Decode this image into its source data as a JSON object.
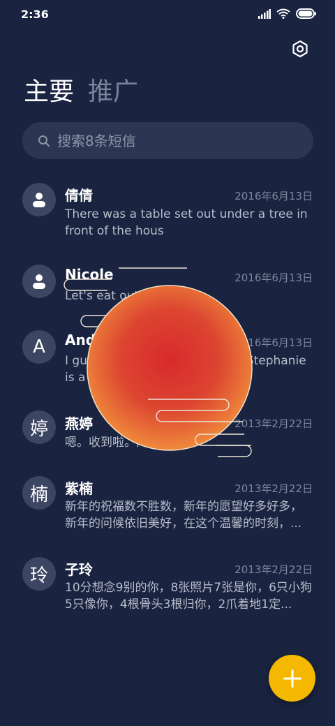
{
  "status_bar": {
    "time": "2:36"
  },
  "tabs": [
    {
      "label": "主要",
      "active": true
    },
    {
      "label": "推广",
      "active": false
    }
  ],
  "search": {
    "placeholder": "搜索8条短信"
  },
  "messages": [
    {
      "avatar": "person-icon",
      "name": "倩倩",
      "date": "2016年6月13日",
      "preview": "There was a table set out under a tree in front of the hous"
    },
    {
      "avatar": "person-icon",
      "name": "Nicole",
      "date": "2016年6月13日",
      "preview": "Let's eat out,shall we?"
    },
    {
      "avatar_text": "A",
      "name": "Andy",
      "date": "2016年6月13日",
      "preview": "I guess you're some lucky guy.Stephanie is a nice girl."
    },
    {
      "avatar_text": "婷",
      "name": "燕婷",
      "date": "2013年2月22日",
      "preview": "嗯。收到啦。同乐同乐。"
    },
    {
      "avatar_text": "楠",
      "name": "紫楠",
      "date": "2013年2月22日",
      "preview": "新年的祝福数不胜数，新年的愿望好多好多，新年的问候依旧美好，在这个温馨的时刻，..."
    },
    {
      "avatar_text": "玲",
      "name": "子玲",
      "date": "2013年2月22日",
      "preview": "10分想念9别的你，8张照片7张是你，6只小狗5只像你，4根骨头3根归你，2爪着地1定..."
    }
  ],
  "colors": {
    "background": "#1a2340",
    "search_bg": "#2c3552",
    "avatar_bg": "#3c4662",
    "fab": "#f5b800",
    "sun_core": "#d8302c",
    "sun_edge": "#ef7a38"
  },
  "icons": {
    "settings": "gear-icon",
    "search": "search-icon",
    "fab": "plus-icon"
  }
}
